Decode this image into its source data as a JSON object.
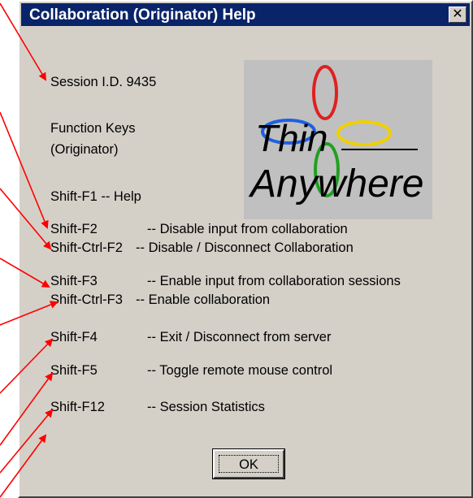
{
  "dialog": {
    "title": "Collaboration (Originator) Help",
    "close_glyph": "✕",
    "session_id": "Session I.D. 9435",
    "function_keys_line1": "Function Keys",
    "function_keys_line2": "(Originator)",
    "help_line": "Shift-F1 -- Help",
    "ok_label": "OK"
  },
  "logo": {
    "line1": "Thin",
    "line2": "Anywhere",
    "petal_colors": [
      "#e02020",
      "#20a020",
      "#2060e0",
      "#f0d000"
    ]
  },
  "keys": [
    {
      "key": "Shift-F2",
      "desc": "-- Disable input from collaboration"
    },
    {
      "key": "Shift-Ctrl-F2",
      "desc": "-- Disable / Disconnect Collaboration"
    },
    {
      "key": "Shift-F3",
      "desc": "-- Enable input from collaboration sessions"
    },
    {
      "key": "Shift-Ctrl-F3",
      "desc": "-- Enable collaboration"
    },
    {
      "key": "Shift-F4",
      "desc": "-- Exit / Disconnect from server"
    },
    {
      "key": "Shift-F5",
      "desc": "-- Toggle remote mouse control"
    },
    {
      "key": "Shift-F12",
      "desc": "-- Session Statistics"
    }
  ],
  "colors": {
    "titlebar": "#0a246a",
    "dialog_bg": "#d4d0c8",
    "arrow": "#ff0000"
  }
}
